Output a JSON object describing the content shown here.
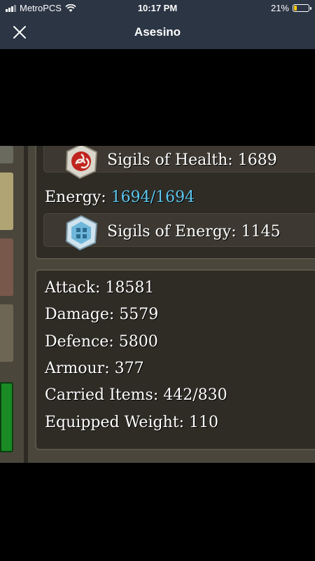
{
  "status_bar": {
    "carrier": "MetroPCS",
    "time": "10:17 PM",
    "battery_percent": "21%",
    "battery_level": 0.21,
    "battery_color": "#ffcc00"
  },
  "nav": {
    "title": "Asesino",
    "close_icon": "close-icon"
  },
  "game": {
    "sigils_health": "Sigils of Health: 1689",
    "energy_label": "Energy: ",
    "energy_current": "1694",
    "energy_separator": "/",
    "energy_max": "1694",
    "energy_color": "#5cc7f0",
    "sigils_energy": "Sigils of Energy: 1145",
    "stats": [
      "Attack: 18581",
      "Damage: 5579",
      "Defence: 5800",
      "Armour: 377",
      "Carried Items: 442/830",
      "Equipped Weight: 110"
    ]
  }
}
